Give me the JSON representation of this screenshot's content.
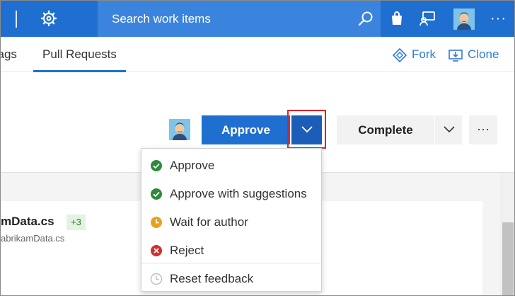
{
  "header": {
    "search_placeholder": "Search work items",
    "icons": [
      "settings-icon",
      "search-icon",
      "marketplace-bag-icon",
      "feedback-icon",
      "user-avatar",
      "more-icon"
    ],
    "more_label": "···"
  },
  "nav": {
    "tabs": [
      {
        "label": "Tags",
        "partial": "Tags"
      },
      {
        "label": "Pull Requests",
        "active": true
      }
    ],
    "actions": {
      "fork_label": "Fork",
      "clone_label": "Clone"
    }
  },
  "pr_actions": {
    "approve_label": "Approve",
    "complete_label": "Complete",
    "more_label": "···"
  },
  "vote_menu": {
    "items": [
      {
        "label": "Approve",
        "icon": "check-circle-green-icon"
      },
      {
        "label": "Approve with suggestions",
        "icon": "check-circle-green-icon"
      },
      {
        "label": "Wait for author",
        "icon": "clock-orange-icon"
      },
      {
        "label": "Reject",
        "icon": "x-circle-red-icon"
      },
      {
        "label": "Reset feedback",
        "icon": "clock-gray-icon"
      }
    ]
  },
  "file": {
    "title": "mData.cs",
    "badge": "+3",
    "path": "abrikamData.cs"
  },
  "colors": {
    "brand_blue": "#1e6fd0",
    "approve_green": "#2e8b3a",
    "wait_orange": "#e8a21a",
    "reject_red": "#d0312d",
    "highlight_red": "#e0202a"
  }
}
